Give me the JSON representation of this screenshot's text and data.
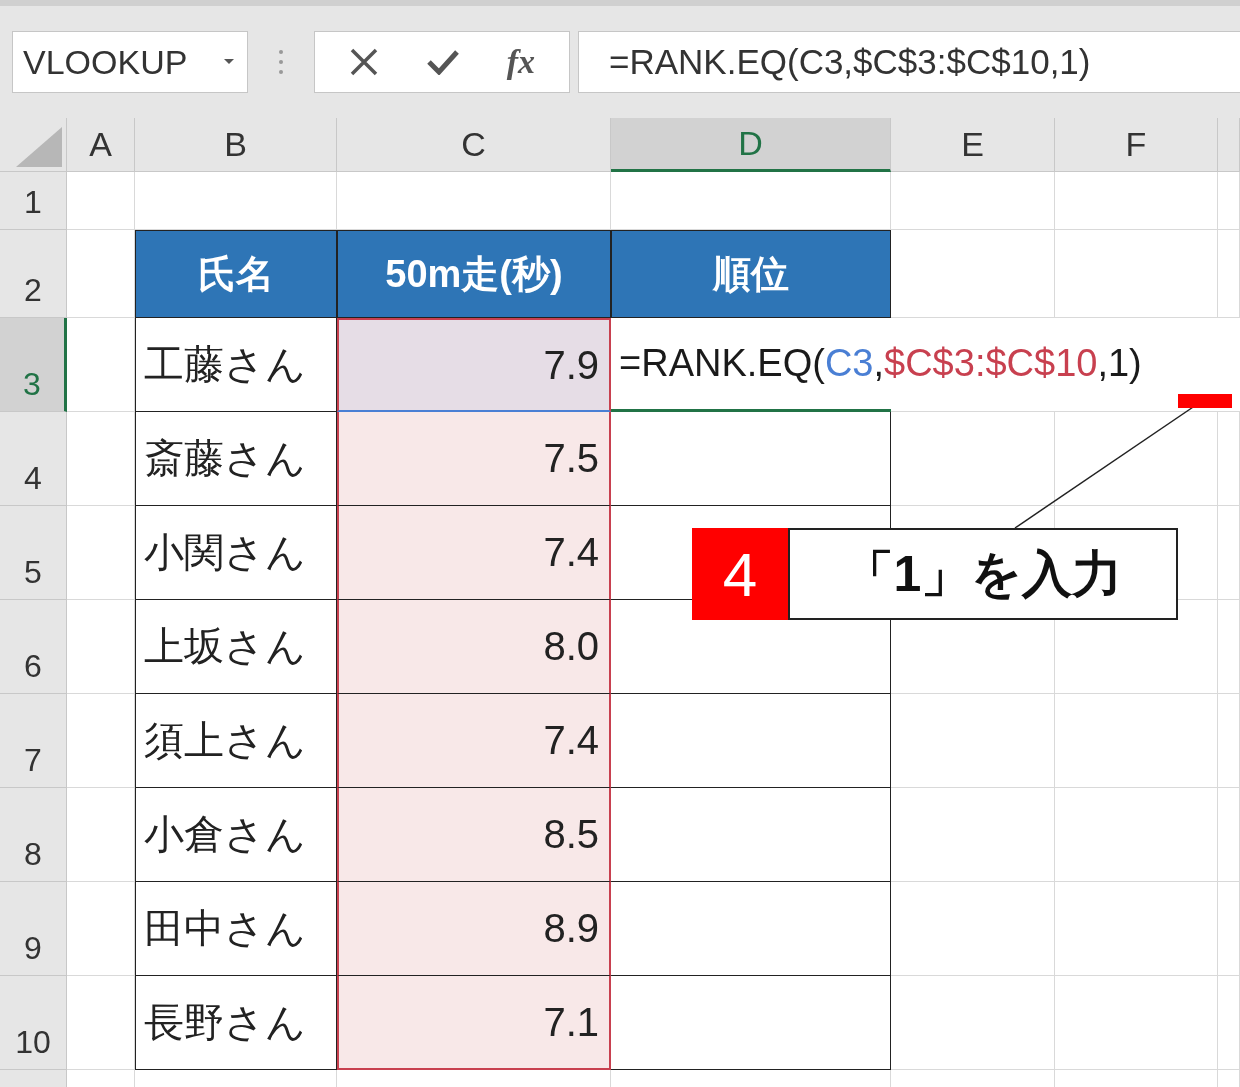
{
  "name_box": {
    "value": "VLOOKUP"
  },
  "formula_bar": {
    "function_label": "fx",
    "formula": "=RANK.EQ(C3,$C$3:$C$10,1)"
  },
  "columns": [
    {
      "label": "A",
      "selected": false
    },
    {
      "label": "B",
      "selected": false
    },
    {
      "label": "C",
      "selected": false
    },
    {
      "label": "D",
      "selected": true
    },
    {
      "label": "E",
      "selected": false
    },
    {
      "label": "F",
      "selected": false
    }
  ],
  "row_headers": [
    {
      "label": "1",
      "selected": false
    },
    {
      "label": "2",
      "selected": false
    },
    {
      "label": "3",
      "selected": true
    },
    {
      "label": "4",
      "selected": false
    },
    {
      "label": "5",
      "selected": false
    },
    {
      "label": "6",
      "selected": false
    },
    {
      "label": "7",
      "selected": false
    },
    {
      "label": "8",
      "selected": false
    },
    {
      "label": "9",
      "selected": false
    },
    {
      "label": "10",
      "selected": false
    }
  ],
  "table": {
    "columns": [
      "氏名",
      "50m走(秒)",
      "順位"
    ],
    "rows": [
      {
        "name": "工藤さん",
        "time": "7.9",
        "formula_parts": [
          {
            "text": "=RANK.EQ(",
            "color": "#1a1a1a"
          },
          {
            "text": "C3",
            "color": "#4a7fd4"
          },
          {
            "text": ",",
            "color": "#1a1a1a"
          },
          {
            "text": "$C$3:$C$10",
            "color": "#c8404f"
          },
          {
            "text": ",1)",
            "color": "#1a1a1a"
          }
        ]
      },
      {
        "name": "斎藤さん",
        "time": "7.5"
      },
      {
        "name": "小関さん",
        "time": "7.4"
      },
      {
        "name": "上坂さん",
        "time": "8.0"
      },
      {
        "name": "須上さん",
        "time": "7.4"
      },
      {
        "name": "小倉さん",
        "time": "8.5"
      },
      {
        "name": "田中さん",
        "time": "8.9"
      },
      {
        "name": "長野さん",
        "time": "7.1"
      }
    ]
  },
  "callout": {
    "step": "4",
    "text": "「1」を入力"
  }
}
